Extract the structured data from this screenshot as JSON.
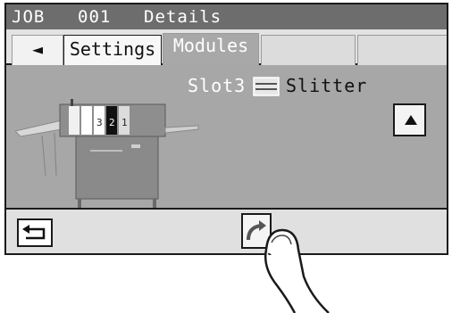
{
  "title_bar": {
    "job": "JOB",
    "number": "001",
    "title": "Details"
  },
  "tabs": [
    {
      "label": "◄",
      "name": "back"
    },
    {
      "label": "Settings",
      "name": "settings"
    },
    {
      "label": "Modules",
      "name": "modules",
      "selected": true
    },
    {
      "label": "",
      "name": "empty-1"
    },
    {
      "label": "",
      "name": "empty-2"
    }
  ],
  "main": {
    "slot": "Slot3",
    "module": "Slitter",
    "machine_slot_numbers": [
      "3",
      "2",
      "1"
    ]
  },
  "icons": {
    "up": "up-arrow-icon",
    "return": "return-arrow-icon",
    "edit": "edit-arrow-icon",
    "slitter": "slitter-icon"
  },
  "colors": {
    "title_bar": "#6d6d6d",
    "main_area": "#a7a7a7",
    "selected_tab": "#a8a8a8",
    "footer": "#e0e0e0"
  }
}
